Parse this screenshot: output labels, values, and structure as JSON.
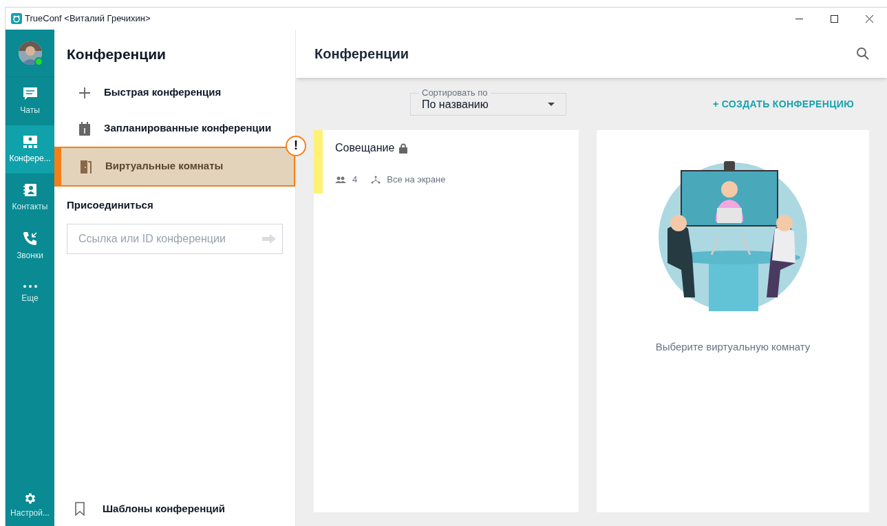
{
  "window": {
    "title": "TrueConf <Виталий Гречихин>"
  },
  "rail": {
    "items": [
      {
        "label": "Чаты",
        "selected": false
      },
      {
        "label": "Конфере...",
        "selected": true
      },
      {
        "label": "Контакты",
        "selected": false
      },
      {
        "label": "Звонки",
        "selected": false
      },
      {
        "label": "Еще",
        "selected": false
      }
    ],
    "settings": {
      "label": "Настрой..."
    }
  },
  "sidebar": {
    "title": "Конференции",
    "items": [
      {
        "label": "Быстрая конференция",
        "selected": false
      },
      {
        "label": "Запланированные конференции",
        "selected": false
      },
      {
        "label": "Виртуальные комнаты",
        "selected": true,
        "callout": "!"
      }
    ],
    "join": {
      "heading": "Присоединиться",
      "placeholder": "Ссылка или ID конференции"
    },
    "footer_item": {
      "label": "Шаблоны конференций"
    }
  },
  "main": {
    "title": "Конференции",
    "sort": {
      "label": "Сортировать по",
      "value": "По названию"
    },
    "create_button": "+ СОЗДАТЬ КОНФЕРЕНЦИЮ",
    "rooms": [
      {
        "name": "Совещание",
        "locked": true,
        "color": "#fff176",
        "participants": "4",
        "mode": "Все на экране"
      }
    ],
    "empty_hint": "Выберите виртуальную комнату"
  }
}
